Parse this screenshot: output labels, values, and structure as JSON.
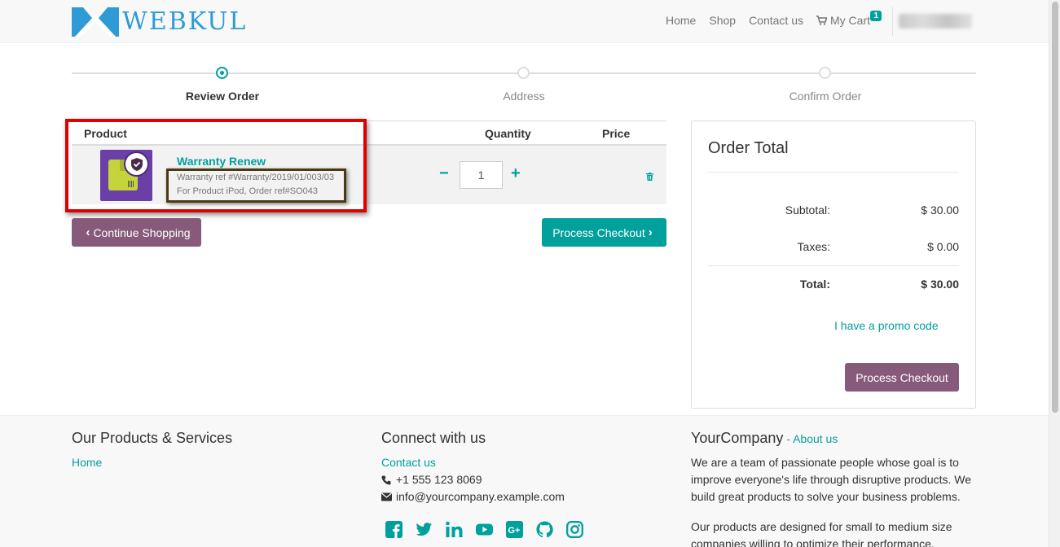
{
  "header": {
    "logo_text": "WEBKUL",
    "nav": [
      "Home",
      "Shop",
      "Contact us"
    ],
    "cart_label": "My Cart",
    "cart_count": "1"
  },
  "wizard": {
    "steps": [
      "Review Order",
      "Address",
      "Confirm Order"
    ],
    "active_index": 0
  },
  "cart": {
    "columns": {
      "product": "Product",
      "quantity": "Quantity",
      "price": "Price"
    },
    "line": {
      "name": "Warranty Renew",
      "desc_line1": "Warranty ref #Warranty/2019/01/003/03",
      "desc_line2": "For Product iPod, Order ref#SO043",
      "quantity": "1"
    },
    "continue_label": "Continue Shopping",
    "checkout_label": "Process Checkout"
  },
  "order_total": {
    "title": "Order Total",
    "subtotal_label": "Subtotal:",
    "subtotal_value": "$ 30.00",
    "taxes_label": "Taxes:",
    "taxes_value": "$ 0.00",
    "total_label": "Total:",
    "total_value": "$ 30.00",
    "promo_label": "I have a promo code",
    "checkout_label": "Process Checkout"
  },
  "footer": {
    "col1_title": "Our Products & Services",
    "col1_link": "Home",
    "col2_title": "Connect with us",
    "col2_link": "Contact us",
    "phone": "+1 555 123 8069",
    "email": "info@yourcompany.example.com",
    "social_icons": [
      "facebook-icon",
      "twitter-icon",
      "linkedin-icon",
      "youtube-icon",
      "google-plus-icon",
      "github-icon",
      "instagram-icon"
    ],
    "col3_title": "YourCompany",
    "col3_sep": " - ",
    "col3_link": "About us",
    "para1": "We are a team of passionate people whose goal is to improve everyone's life through disruptive products. We build great products to solve your business problems.",
    "para2": "Our products are designed for small to medium size companies willing to optimize their performance."
  },
  "colors": {
    "accent": "#00a09d",
    "secondary": "#875a7b",
    "highlight_red": "#e00000",
    "highlight_brown": "#4a3a12",
    "logo_blue": "#2f9bd6"
  }
}
